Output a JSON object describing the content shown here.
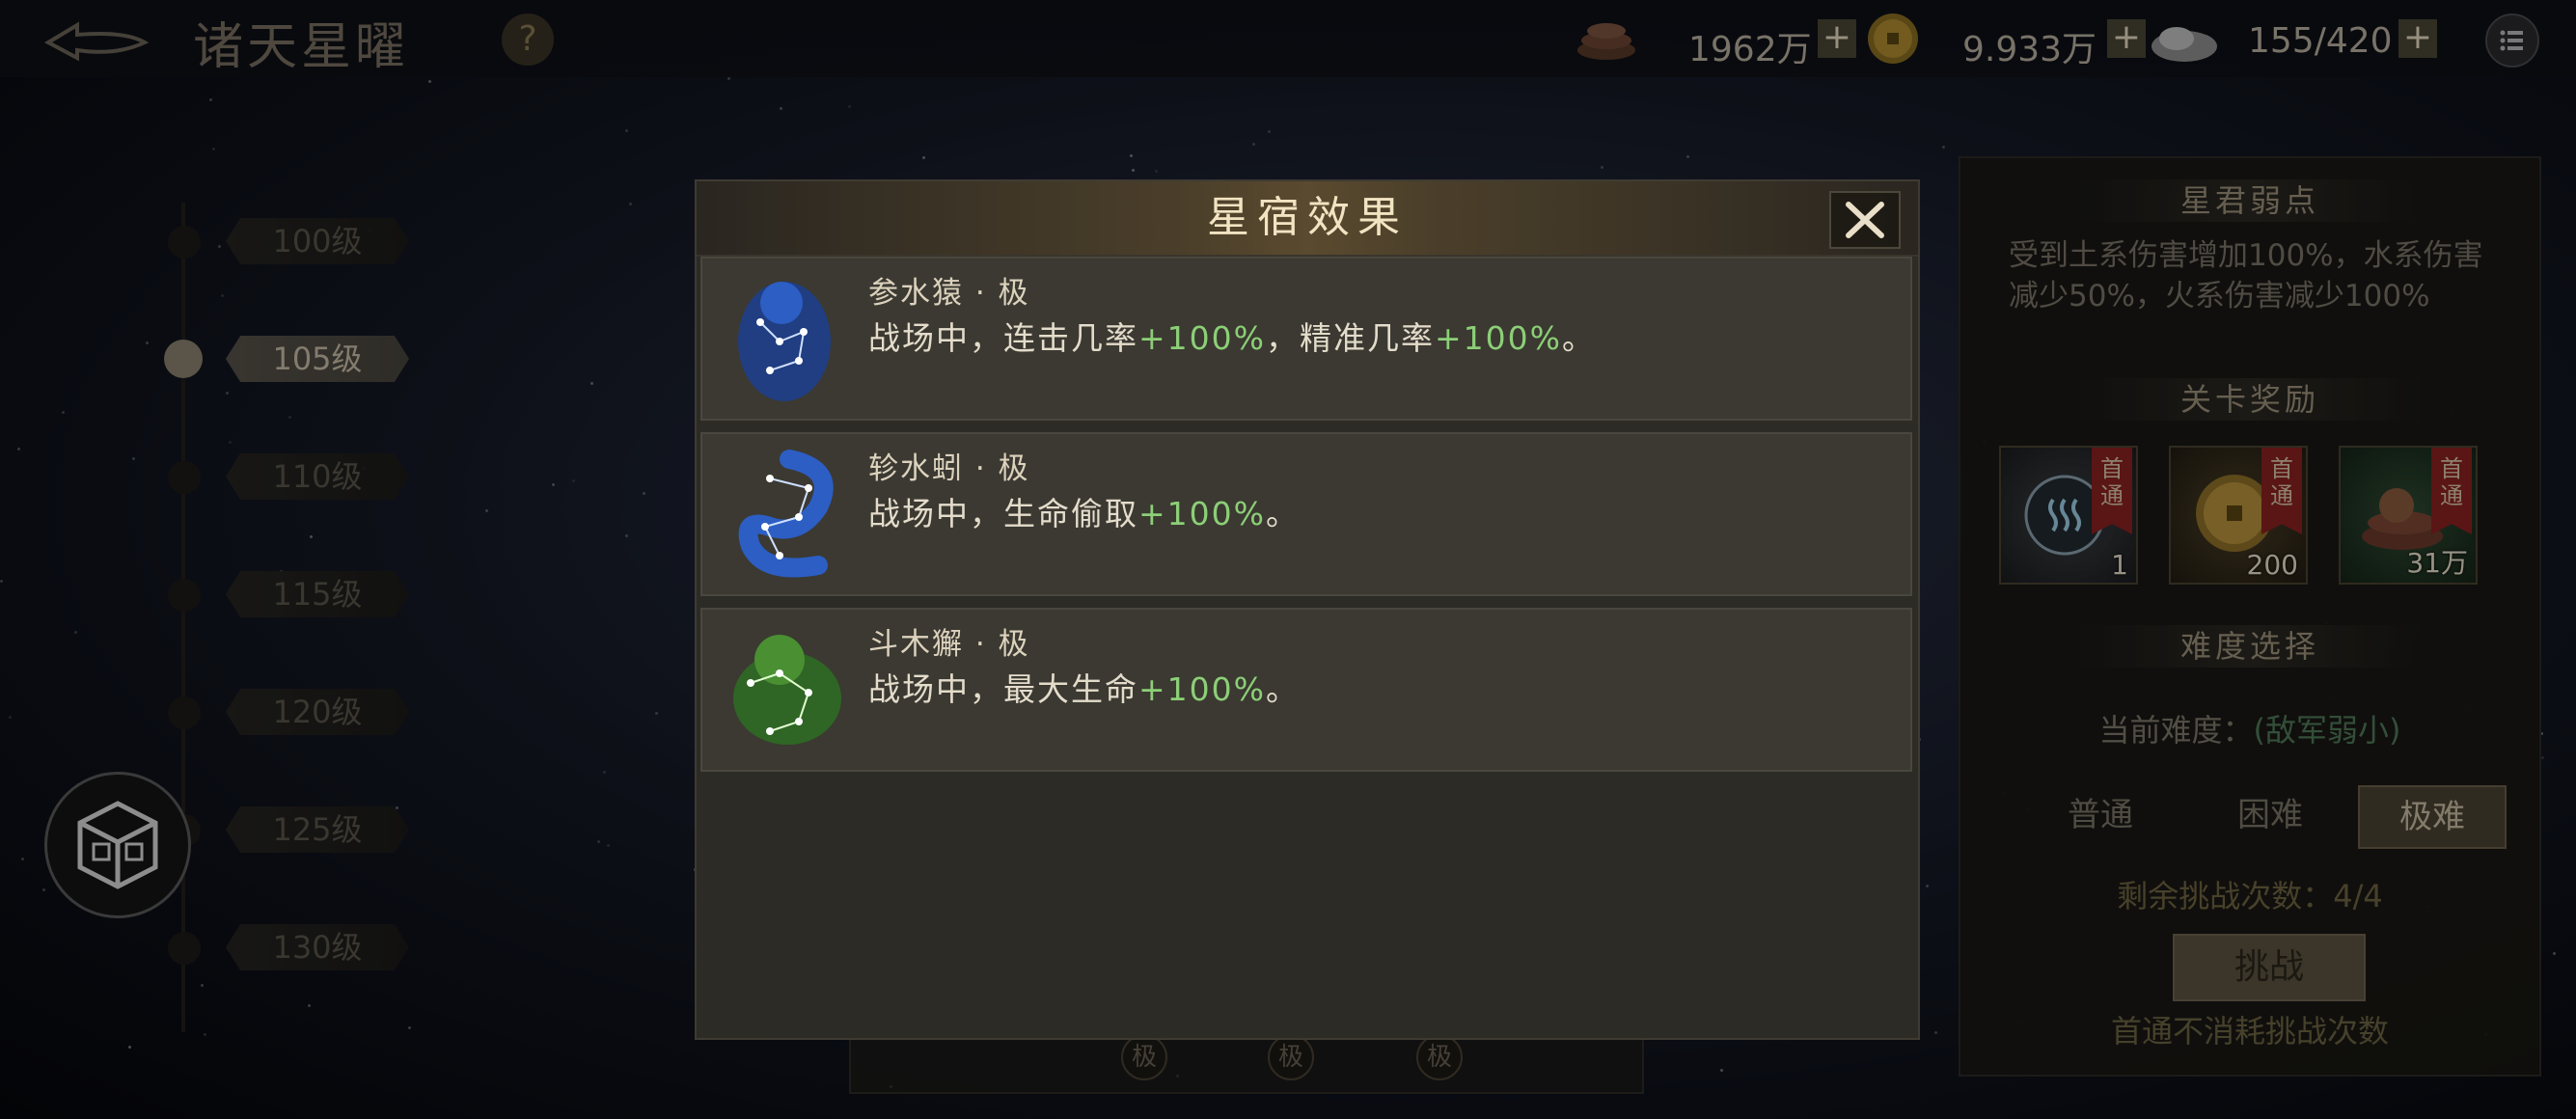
{
  "header": {
    "title": "诸天星曜",
    "help_label": "?",
    "resources": [
      {
        "icon": "ingot-stack-icon",
        "value": "1962万"
      },
      {
        "icon": "gold-coin-icon",
        "value": "9.933万"
      },
      {
        "icon": "jade-stone-icon",
        "value": "155/420"
      }
    ],
    "plus_label": "+"
  },
  "levels": [
    "100级",
    "105级",
    "110级",
    "115级",
    "120级",
    "125级",
    "130级"
  ],
  "active_level_index": 1,
  "right_panel": {
    "weakness_title": "星君弱点",
    "weakness_text": "受到土系伤害增加100%，水系伤害减少50%，火系伤害减少100%",
    "reward_title": "关卡奖励",
    "rewards": [
      {
        "icon": "water-orb-icon",
        "badge": "首通",
        "count": "1"
      },
      {
        "icon": "gold-coin-icon",
        "badge": "首通",
        "count": "200"
      },
      {
        "icon": "copper-coins-icon",
        "badge": "首通",
        "count": "31万"
      }
    ],
    "difficulty_title": "难度选择",
    "difficulty_current_label": "当前难度：",
    "difficulty_current_value": "(敌军弱小)",
    "difficulty_options": [
      "普通",
      "困难",
      "极难"
    ],
    "difficulty_selected": "极难",
    "remaining_label": "剩余挑战次数：4/4",
    "challenge_label": "挑战",
    "first_clear_note": "首通不消耗挑战次数"
  },
  "background_tags": [
    "极",
    "极",
    "极"
  ],
  "modal": {
    "title": "星宿效果",
    "items": [
      {
        "icon": "ape-constellation-icon",
        "name": "参水猿 · 极",
        "desc_prefix": "战场中，连击几率",
        "pct1": "+100%",
        "desc_mid": "，精准几率",
        "pct2": "+100%",
        "desc_suffix": "。",
        "color": "#3a6fd8"
      },
      {
        "icon": "earthworm-constellation-icon",
        "name": "轸水蚓 · 极",
        "desc_prefix": "战场中，生命偷取",
        "pct1": "+100%",
        "desc_suffix": "。",
        "color": "#3a6fd8"
      },
      {
        "icon": "lion-constellation-icon",
        "name": "斗木獬 · 极",
        "desc_prefix": "战场中，最大生命",
        "pct1": "+100%",
        "desc_suffix": "。",
        "color": "#5aa33a"
      }
    ]
  }
}
